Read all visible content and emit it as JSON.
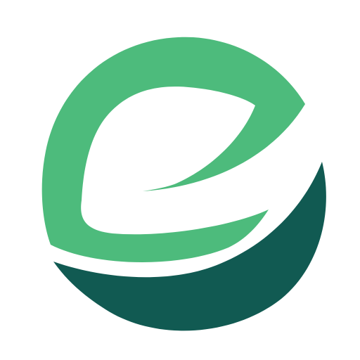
{
  "logo": {
    "icon": "leaf-letter-e-icon",
    "colors": {
      "light_green": "#4DBB7C",
      "dark_green": "#115A52",
      "background": "#FFFFFF"
    }
  }
}
